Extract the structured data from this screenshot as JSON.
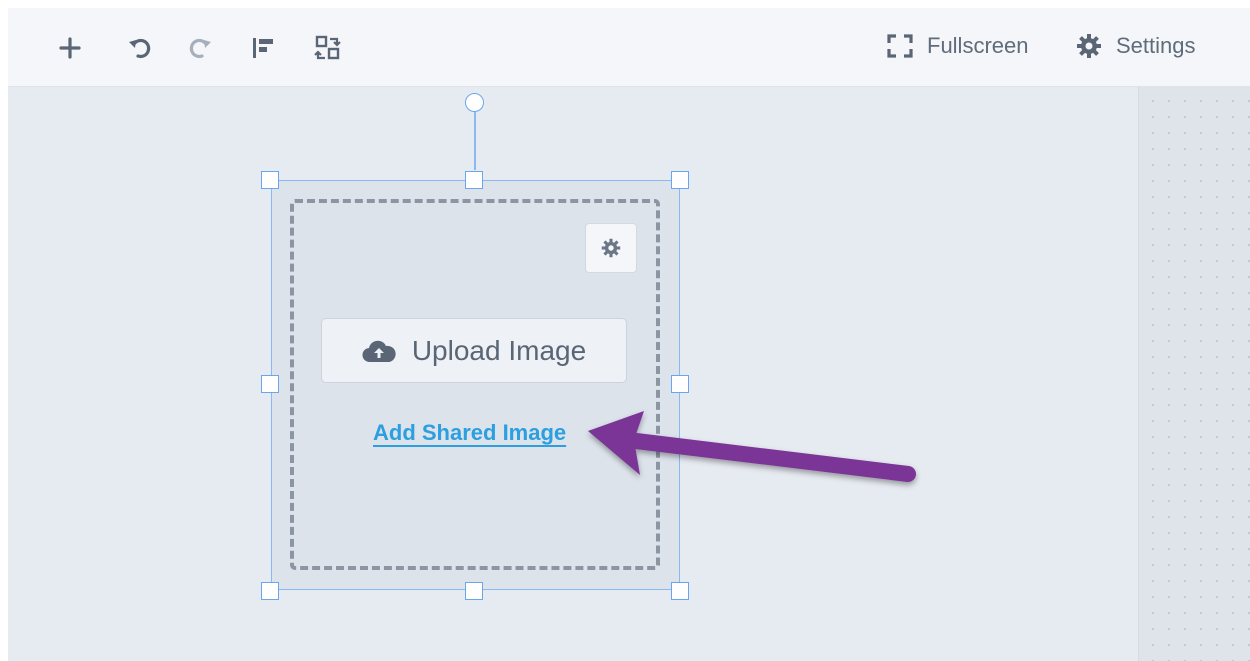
{
  "toolbar": {
    "left_icons": [
      "plus-icon",
      "undo-icon",
      "redo-icon",
      "align-icon",
      "arrange-icon"
    ],
    "fullscreen_label": "Fullscreen",
    "fullscreen_icon": "fullscreen-icon",
    "settings_label": "Settings",
    "settings_icon": "gear-icon"
  },
  "image_widget": {
    "settings_icon": "gear-icon",
    "upload_label": "Upload Image",
    "upload_icon": "cloud-upload-icon",
    "shared_link_label": "Add Shared Image"
  },
  "annotation": {
    "arrow_color": "#7a3596"
  },
  "colors": {
    "selection": "#8ab8f2",
    "link": "#2b9fe0",
    "canvas": "#e6eaf1"
  }
}
